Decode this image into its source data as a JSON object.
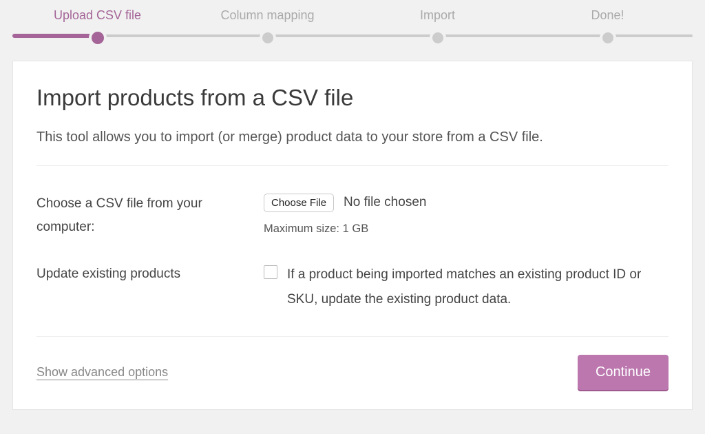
{
  "colors": {
    "accent": "#a46497",
    "button": "#bb77ae"
  },
  "stepper": {
    "steps": [
      {
        "label": "Upload CSV file",
        "active": true
      },
      {
        "label": "Column mapping",
        "active": false
      },
      {
        "label": "Import",
        "active": false
      },
      {
        "label": "Done!",
        "active": false
      }
    ]
  },
  "page": {
    "title": "Import products from a CSV file",
    "description": "This tool allows you to import (or merge) product data to your store from a CSV file."
  },
  "form": {
    "file": {
      "label": "Choose a CSV file from your computer:",
      "button": "Choose File",
      "status": "No file chosen",
      "hint": "Maximum size: 1 GB"
    },
    "update": {
      "label": "Update existing products",
      "checked": false,
      "description": "If a product being imported matches an existing product ID or SKU, update the existing product data."
    }
  },
  "footer": {
    "advanced": "Show advanced options",
    "continue": "Continue"
  }
}
